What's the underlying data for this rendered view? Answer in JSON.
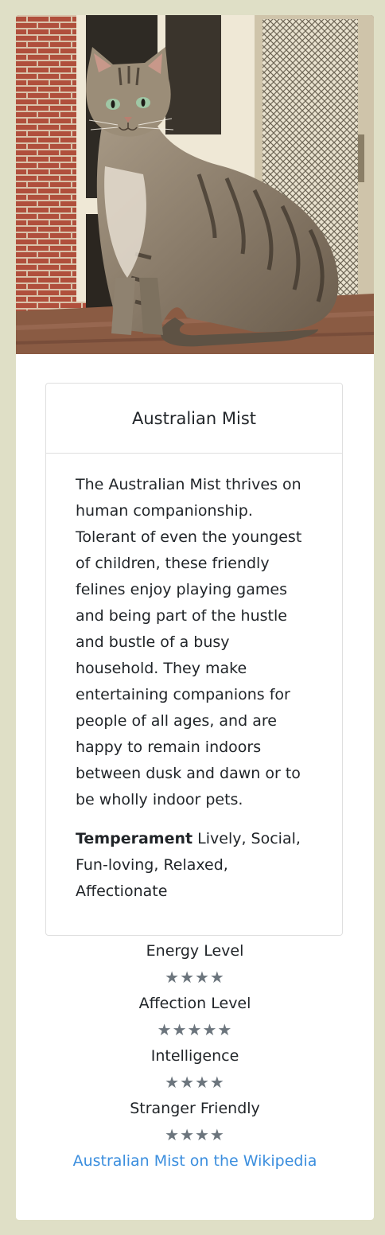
{
  "breed": {
    "name": "Australian Mist",
    "image_alt": "Australian Mist",
    "description": "The Australian Mist thrives on human companionship. Tolerant of even the youngest of children, these friendly felines enjoy playing games and being part of the hustle and bustle of a busy household. They make entertaining companions for people of all ages, and are happy to remain indoors between dusk and dawn or to be wholly indoor pets.",
    "temperament_label": "Temperament",
    "temperament": "Lively, Social, Fun-loving, Relaxed, Affectionate"
  },
  "ratings": [
    {
      "label": "Energy Level",
      "stars": "★★★★",
      "value": 4
    },
    {
      "label": "Affection Level",
      "stars": "★★★★★",
      "value": 5
    },
    {
      "label": "Intelligence",
      "stars": "★★★★",
      "value": 4
    },
    {
      "label": "Stranger Friendly",
      "stars": "★★★★",
      "value": 4
    }
  ],
  "wikipedia_link": {
    "label": "Australian Mist on the Wikipedia"
  },
  "colors": {
    "page_background": "#dfdfc6",
    "card_background": "#ffffff",
    "star_color": "#6c757d",
    "link_color": "#3b8ede"
  }
}
